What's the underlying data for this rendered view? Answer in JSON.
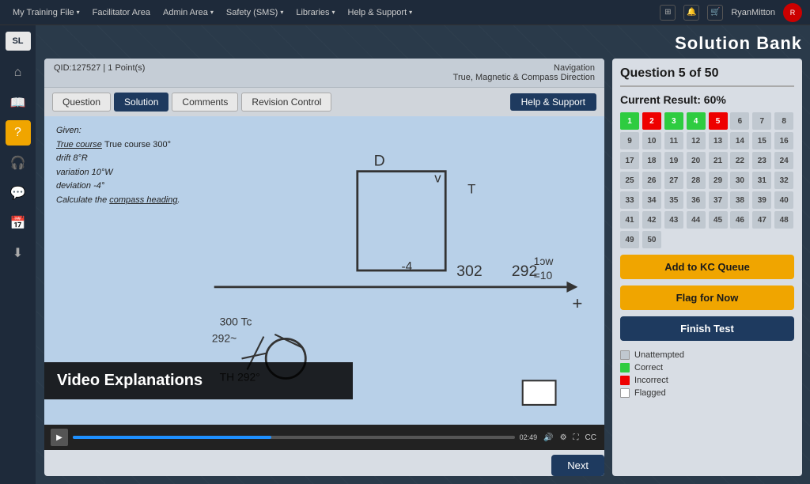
{
  "topNav": {
    "items": [
      {
        "label": "My Training File",
        "hasDropdown": true
      },
      {
        "label": "Facilitator Area",
        "hasDropdown": false
      },
      {
        "label": "Admin Area",
        "hasDropdown": true
      },
      {
        "label": "Safety (SMS)",
        "hasDropdown": true
      },
      {
        "label": "Libraries",
        "hasDropdown": true
      },
      {
        "label": "Help & Support",
        "hasDropdown": true
      }
    ],
    "userName": "RyanMitton",
    "gridIcon": "⊞",
    "notifIcon": "🔔",
    "cartIcon": "🛒"
  },
  "sidebar": {
    "logo": "SL",
    "icons": [
      {
        "name": "home",
        "symbol": "⌂",
        "active": false
      },
      {
        "name": "book",
        "symbol": "📖",
        "active": false
      },
      {
        "name": "question",
        "symbol": "?",
        "active": true
      },
      {
        "name": "headset",
        "symbol": "🎧",
        "active": false
      },
      {
        "name": "chat",
        "symbol": "💬",
        "active": false
      },
      {
        "name": "calendar",
        "symbol": "📅",
        "active": false
      },
      {
        "name": "download",
        "symbol": "⬇",
        "active": false
      }
    ]
  },
  "pageTitle": "Solution Bank",
  "questionHeader": {
    "qid": "QID:127527  |  1 Point(s)",
    "navLabel": "Navigation",
    "navSub": "True, Magnetic & Compass Direction"
  },
  "tabs": [
    {
      "label": "Question",
      "active": false
    },
    {
      "label": "Solution",
      "active": true
    },
    {
      "label": "Comments",
      "active": false
    },
    {
      "label": "Revision Control",
      "active": false
    }
  ],
  "helpSupportBtn": "Help & Support",
  "videoCaption": "Video Explanations",
  "videoTime": "02:49",
  "nextBtn": "Next",
  "rightPanel": {
    "questionCounter": "Question 5 of 50",
    "currentResult": "Current Result: 60%",
    "addToKCQueue": "Add to KC Queue",
    "flagForNow": "Flag for Now",
    "finishTest": "Finish Test",
    "legend": [
      {
        "label": "Unattempted",
        "type": "unattempted"
      },
      {
        "label": "Correct",
        "type": "correct"
      },
      {
        "label": "Incorrect",
        "type": "incorrect"
      },
      {
        "label": "Flagged",
        "type": "flagged"
      }
    ],
    "questions": [
      {
        "num": 1,
        "state": "correct"
      },
      {
        "num": 2,
        "state": "incorrect"
      },
      {
        "num": 3,
        "state": "correct"
      },
      {
        "num": 4,
        "state": "correct"
      },
      {
        "num": 5,
        "state": "incorrect"
      },
      {
        "num": 6,
        "state": "unattempted"
      },
      {
        "num": 7,
        "state": "unattempted"
      },
      {
        "num": 8,
        "state": "unattempted"
      },
      {
        "num": 9,
        "state": "unattempted"
      },
      {
        "num": 10,
        "state": "unattempted"
      },
      {
        "num": 11,
        "state": "unattempted"
      },
      {
        "num": 12,
        "state": "unattempted"
      },
      {
        "num": 13,
        "state": "unattempted"
      },
      {
        "num": 14,
        "state": "unattempted"
      },
      {
        "num": 15,
        "state": "unattempted"
      },
      {
        "num": 16,
        "state": "unattempted"
      },
      {
        "num": 17,
        "state": "unattempted"
      },
      {
        "num": 18,
        "state": "unattempted"
      },
      {
        "num": 19,
        "state": "unattempted"
      },
      {
        "num": 20,
        "state": "unattempted"
      },
      {
        "num": 21,
        "state": "unattempted"
      },
      {
        "num": 22,
        "state": "unattempted"
      },
      {
        "num": 23,
        "state": "unattempted"
      },
      {
        "num": 24,
        "state": "unattempted"
      },
      {
        "num": 25,
        "state": "unattempted"
      },
      {
        "num": 26,
        "state": "unattempted"
      },
      {
        "num": 27,
        "state": "unattempted"
      },
      {
        "num": 28,
        "state": "unattempted"
      },
      {
        "num": 29,
        "state": "unattempted"
      },
      {
        "num": 30,
        "state": "unattempted"
      },
      {
        "num": 31,
        "state": "unattempted"
      },
      {
        "num": 32,
        "state": "unattempted"
      },
      {
        "num": 33,
        "state": "unattempted"
      },
      {
        "num": 34,
        "state": "unattempted"
      },
      {
        "num": 35,
        "state": "unattempted"
      },
      {
        "num": 36,
        "state": "unattempted"
      },
      {
        "num": 37,
        "state": "unattempted"
      },
      {
        "num": 38,
        "state": "unattempted"
      },
      {
        "num": 39,
        "state": "unattempted"
      },
      {
        "num": 40,
        "state": "unattempted"
      },
      {
        "num": 41,
        "state": "unattempted"
      },
      {
        "num": 42,
        "state": "unattempted"
      },
      {
        "num": 43,
        "state": "unattempted"
      },
      {
        "num": 44,
        "state": "unattempted"
      },
      {
        "num": 45,
        "state": "unattempted"
      },
      {
        "num": 46,
        "state": "unattempted"
      },
      {
        "num": 47,
        "state": "unattempted"
      },
      {
        "num": 48,
        "state": "unattempted"
      },
      {
        "num": 49,
        "state": "unattempted"
      },
      {
        "num": 50,
        "state": "unattempted"
      }
    ]
  },
  "handwriting": {
    "line1": "Given:",
    "line2": "True course 300°",
    "line3": "drift 8°R",
    "line4": "variation 10°W",
    "line5": "deviation -4°",
    "line6": "Calculate the compass heading."
  }
}
